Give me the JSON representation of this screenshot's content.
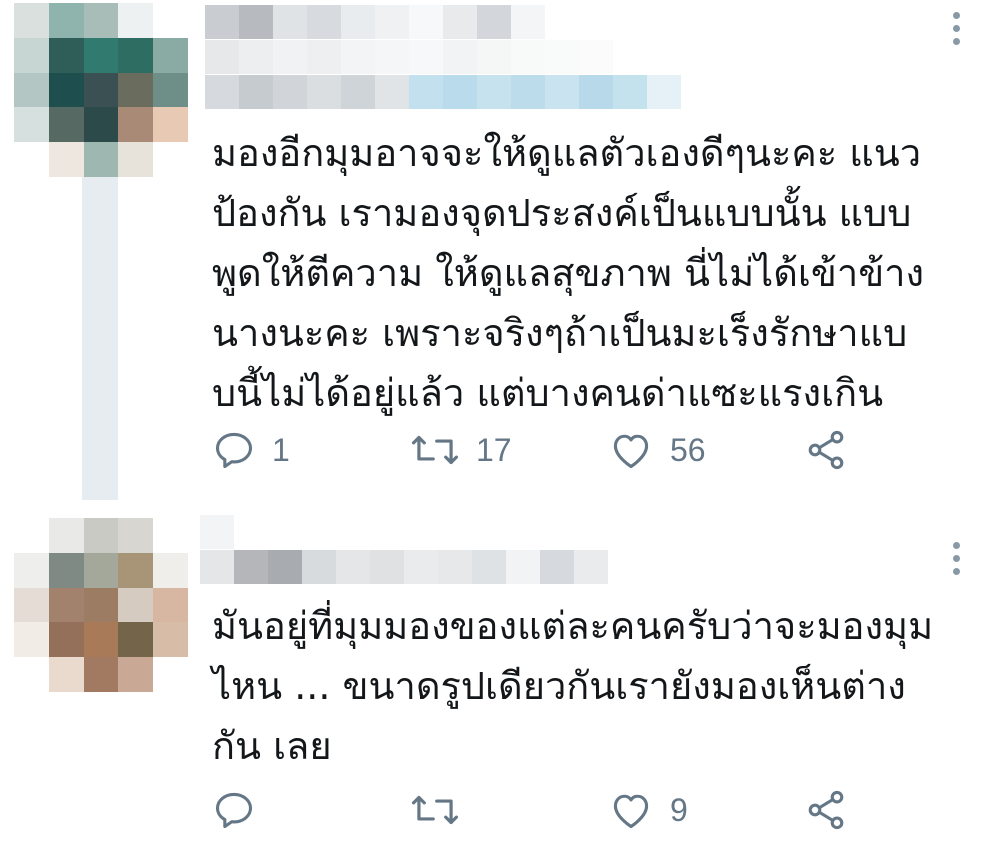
{
  "tweets": [
    {
      "text": "มองอีกมุมอาจจะให้ดูแลตัวเองดีๆนะคะ แนว\nป้องกัน เรามองจุดประสงค์เป็นแบบนั้น แบบ\nพูดให้ตีความ ให้ดูแลสุขภาพ นี่ไม่ได้เข้าข้าง\nนางนะคะ  เพราะจริงๆถ้าเป็นมะเร็งรักษาแบ\nบนี้ไม่ได้อยู่แล้ว แต่บางคนด่าแซะแรงเกิน",
      "reply_count": "1",
      "retweet_count": "17",
      "like_count": "56",
      "icons": {
        "reply": "reply-icon",
        "retweet": "retweet-icon",
        "like": "heart-icon",
        "share": "share-icon",
        "more": "more-options-icon"
      }
    },
    {
      "text": "มันอยู่ที่มุมมองของแต่ละคนครับว่าจะมองมุม\nไหน ... ขนาดรูปเดียวกันเรายังมองเห็นต่าง\nกัน เลย",
      "reply_count": "",
      "retweet_count": "",
      "like_count": "9",
      "icons": {
        "reply": "reply-icon",
        "retweet": "retweet-icon",
        "like": "heart-icon",
        "share": "share-icon",
        "more": "more-options-icon"
      }
    }
  ],
  "colors": {
    "icon_gray": "#657786",
    "text": "#14171a",
    "thread_line": "#e6ecf0",
    "background": "#ffffff"
  }
}
